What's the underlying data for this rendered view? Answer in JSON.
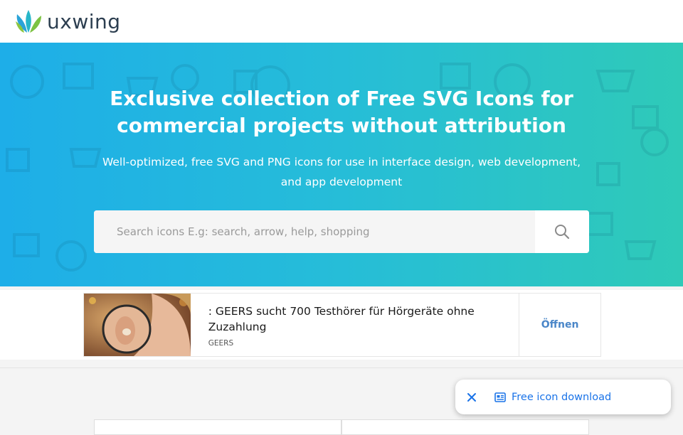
{
  "header": {
    "logo_text": "uxwing",
    "logo_icon": "uxwing-wing-logo"
  },
  "hero": {
    "title_line1": "Exclusive collection of Free SVG Icons for",
    "title_line2": "commercial projects without attribution",
    "subtitle_line1": "Well-optimized, free SVG and PNG icons for use in interface design, web development,",
    "subtitle_line2": "and app development",
    "gradient_start": "#1eaee8",
    "gradient_end": "#2fcab8"
  },
  "search": {
    "placeholder": "Search icons E.g: search, arrow, help, shopping",
    "button_icon": "search-icon"
  },
  "ad": {
    "headline": ": GEERS sucht 700 Testhörer für Hörgeräte ohne Zuzahlung",
    "source": "GEERS",
    "cta": "Öffnen",
    "cta_color": "#4a86c8"
  },
  "toast": {
    "close_icon": "close-icon",
    "link_icon": "newspaper-icon",
    "link_label": "Free icon download",
    "link_color": "#1a73e8"
  }
}
